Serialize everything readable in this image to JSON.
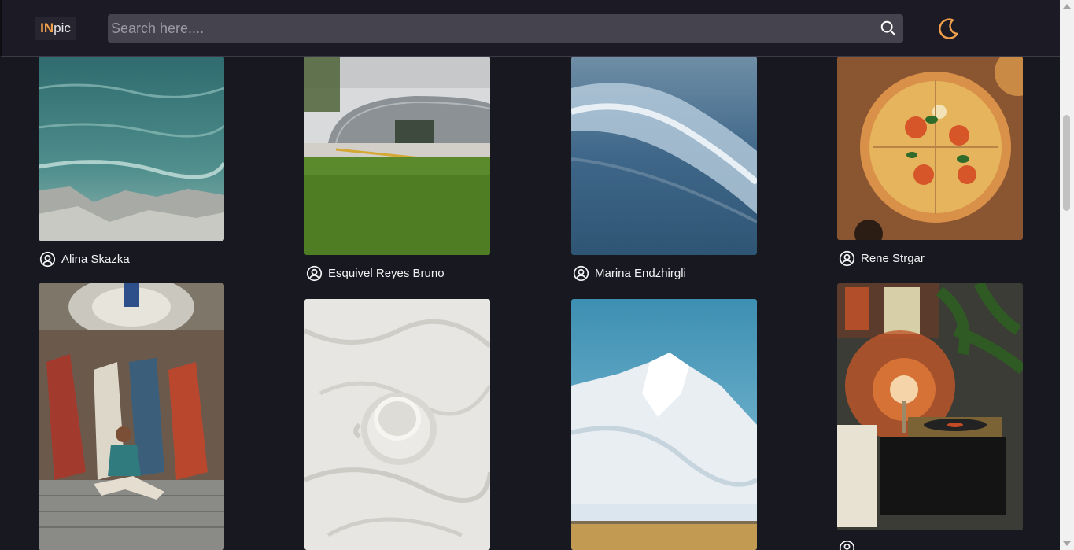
{
  "header": {
    "logo_in": "IN",
    "logo_pic": "pic",
    "search_placeholder": "Search here....",
    "search_icon": "search-icon",
    "theme_icon": "moon-icon"
  },
  "colors": {
    "background": "#181820",
    "accent": "#f0a04b",
    "search_bg": "#45444e"
  },
  "gallery": [
    {
      "author": "Alina Skazka",
      "image": "sea-rocks"
    },
    {
      "author": "Esquivel Reyes Bruno",
      "image": "modern-building"
    },
    {
      "author": "Marina Endzhirgli",
      "image": "ocean-wave"
    },
    {
      "author": "Rene Strgar",
      "image": "pizza"
    },
    {
      "author": "",
      "image": "mural-man"
    },
    {
      "author": "",
      "image": "coffee-cup-bed"
    },
    {
      "author": "",
      "image": "snow-mountain"
    },
    {
      "author": "",
      "image": "lamp-record-player"
    }
  ]
}
